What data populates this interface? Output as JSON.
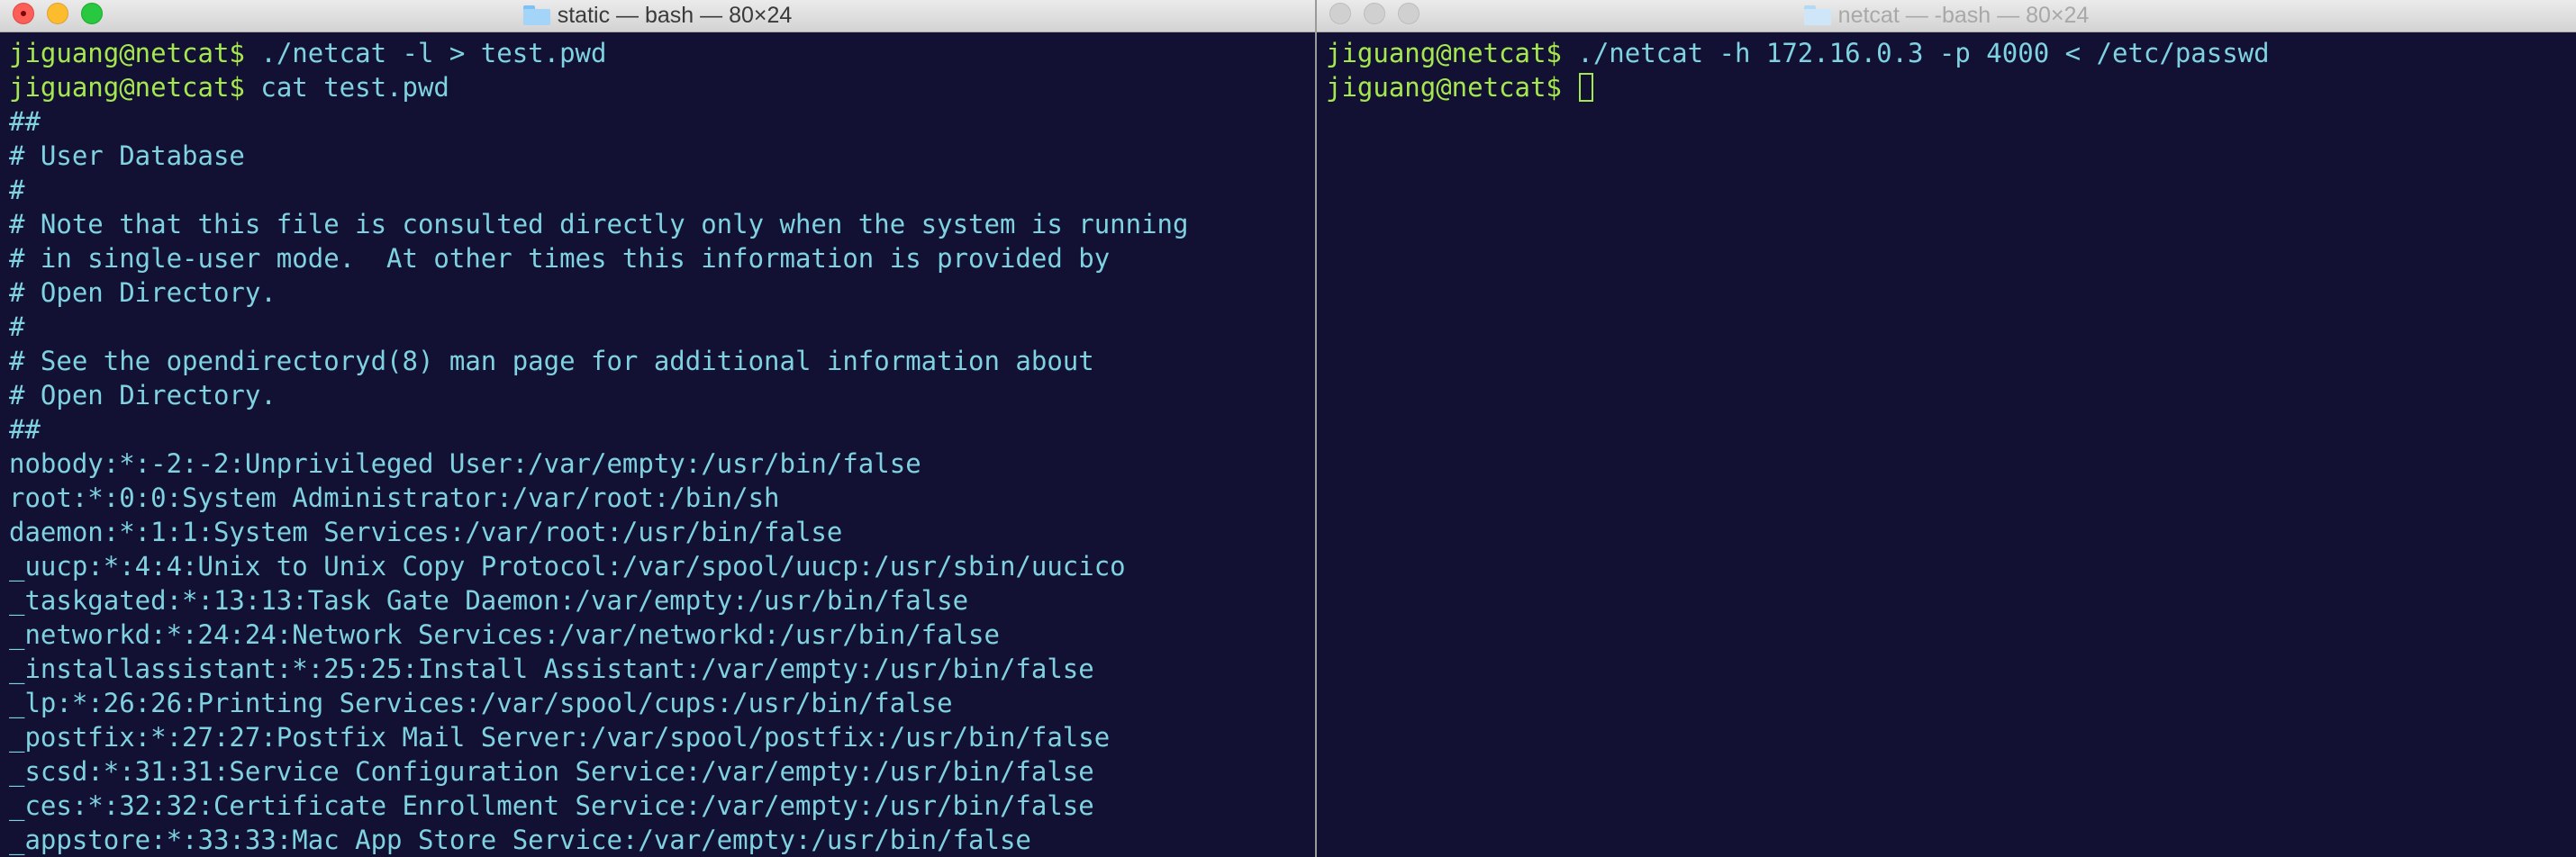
{
  "left_window": {
    "title": "static — bash — 80×24",
    "lines": [
      {
        "prompt": "jiguang@netcat$",
        "cmd": " ./netcat -l > test.pwd"
      },
      {
        "prompt": "jiguang@netcat$",
        "cmd": " cat test.pwd"
      },
      {
        "text": "##"
      },
      {
        "text": "# User Database"
      },
      {
        "text": "#"
      },
      {
        "text": "# Note that this file is consulted directly only when the system is running"
      },
      {
        "text": "# in single-user mode.  At other times this information is provided by"
      },
      {
        "text": "# Open Directory."
      },
      {
        "text": "#"
      },
      {
        "text": "# See the opendirectoryd(8) man page for additional information about"
      },
      {
        "text": "# Open Directory."
      },
      {
        "text": "##"
      },
      {
        "text": "nobody:*:-2:-2:Unprivileged User:/var/empty:/usr/bin/false"
      },
      {
        "text": "root:*:0:0:System Administrator:/var/root:/bin/sh"
      },
      {
        "text": "daemon:*:1:1:System Services:/var/root:/usr/bin/false"
      },
      {
        "text": "_uucp:*:4:4:Unix to Unix Copy Protocol:/var/spool/uucp:/usr/sbin/uucico"
      },
      {
        "text": "_taskgated:*:13:13:Task Gate Daemon:/var/empty:/usr/bin/false"
      },
      {
        "text": "_networkd:*:24:24:Network Services:/var/networkd:/usr/bin/false"
      },
      {
        "text": "_installassistant:*:25:25:Install Assistant:/var/empty:/usr/bin/false"
      },
      {
        "text": "_lp:*:26:26:Printing Services:/var/spool/cups:/usr/bin/false"
      },
      {
        "text": "_postfix:*:27:27:Postfix Mail Server:/var/spool/postfix:/usr/bin/false"
      },
      {
        "text": "_scsd:*:31:31:Service Configuration Service:/var/empty:/usr/bin/false"
      },
      {
        "text": "_ces:*:32:32:Certificate Enrollment Service:/var/empty:/usr/bin/false"
      },
      {
        "text": "_appstore:*:33:33:Mac App Store Service:/var/empty:/usr/bin/false"
      }
    ]
  },
  "right_window": {
    "title": "netcat — -bash — 80×24",
    "lines": [
      {
        "prompt": "jiguang@netcat$",
        "cmd": " ./netcat -h 172.16.0.3 -p 4000 < /etc/passwd"
      },
      {
        "prompt": "jiguang@netcat$",
        "cmd": " "
      }
    ]
  },
  "colors": {
    "terminal_bg": "#121134",
    "prompt": "#a5e84e",
    "text": "#7fd2e0"
  },
  "icons": [
    "folder-icon",
    "close-icon",
    "minimize-icon",
    "zoom-icon"
  ]
}
